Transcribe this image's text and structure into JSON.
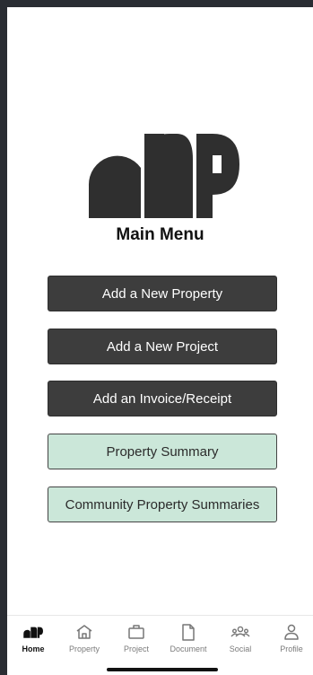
{
  "main": {
    "title": "Main Menu"
  },
  "menu": {
    "add_property": "Add a New Property",
    "add_project": "Add a New Project",
    "add_invoice": "Add an Invoice/Receipt",
    "property_summary": "Property Summary",
    "community_summaries": "Community Property Summaries"
  },
  "tabs": {
    "home": "Home",
    "property": "Property",
    "project": "Project",
    "document": "Document",
    "social": "Social",
    "profile": "Profile"
  },
  "icons": {
    "logo": "ap-logo",
    "home": "ap-logo-icon",
    "property": "house-icon",
    "project": "briefcase-icon",
    "document": "document-icon",
    "social": "people-icon",
    "profile": "person-icon"
  },
  "colors": {
    "dark_button": "#3d3d3d",
    "light_button": "#cbe7d9",
    "logo": "#2f2f2f"
  }
}
